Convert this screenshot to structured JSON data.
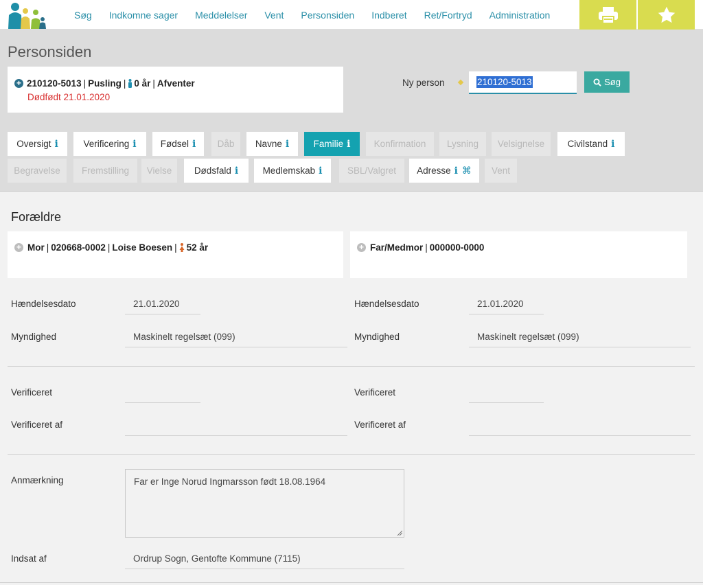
{
  "nav": {
    "items": [
      "Søg",
      "Indkomne sager",
      "Meddelelser",
      "Vent",
      "Personsiden",
      "Indberet",
      "Ret/Fortryd",
      "Administration"
    ]
  },
  "page": {
    "title": "Personsiden"
  },
  "person": {
    "cpr": "210120-5013",
    "name": "Pusling",
    "age": "0 år",
    "status": "Afventer",
    "death_note": "Dødfødt 21.01.2020"
  },
  "search": {
    "label": "Ny person",
    "value": "210120-5013",
    "button_label": "Søg"
  },
  "tabs_row1": [
    {
      "label": "Oversigt",
      "state": "enabled",
      "info": true
    },
    {
      "label": "Verificering",
      "state": "enabled",
      "info": true
    },
    {
      "label": "Fødsel",
      "state": "enabled",
      "info": true
    },
    {
      "label": "Dåb",
      "state": "disabled",
      "info": false
    },
    {
      "label": "Navne",
      "state": "enabled",
      "info": true
    },
    {
      "label": "Familie",
      "state": "active",
      "info": true
    },
    {
      "label": "Konfirmation",
      "state": "disabled",
      "info": false
    },
    {
      "label": "Lysning",
      "state": "disabled",
      "info": false
    },
    {
      "label": "Velsignelse",
      "state": "disabled",
      "info": false
    },
    {
      "label": "Civilstand",
      "state": "enabled",
      "info": true
    }
  ],
  "tabs_row2": [
    {
      "label": "Begravelse",
      "state": "disabled",
      "info": false
    },
    {
      "label": "Fremstilling",
      "state": "disabled",
      "info": false
    },
    {
      "label": "Vielse",
      "state": "disabled",
      "info": false
    },
    {
      "label": "Dødsfald",
      "state": "enabled",
      "info": true
    },
    {
      "label": "Medlemskab",
      "state": "enabled",
      "info": true
    },
    {
      "label": "SBL/Valgret",
      "state": "disabled",
      "info": false
    },
    {
      "label": "Adresse",
      "state": "enabled",
      "info": true
    },
    {
      "label": "Vent",
      "state": "disabled",
      "info": false
    }
  ],
  "parents": {
    "title": "Forældre",
    "mother": {
      "role": "Mor",
      "cpr": "020668-0002",
      "name": "Loise Boesen",
      "age": "52 år"
    },
    "father": {
      "role": "Far/Medmor",
      "cpr": "000000-0000"
    }
  },
  "fields": {
    "haendelsesdato_label": "Hændelsesdato",
    "myndighed_label": "Myndighed",
    "verificeret_label": "Verificeret",
    "verificeret_af_label": "Verificeret af",
    "mother_date": "21.01.2020",
    "mother_authority": "Maskinelt regelsæt (099)",
    "father_date": "21.01.2020",
    "father_authority": "Maskinelt regelsæt (099)"
  },
  "remark": {
    "label": "Anmærkning",
    "text": "Far er Inge Norud Ingmarsson født 18.08.1964",
    "inserted_label": "Indsat af",
    "inserted_by": "Ordrup Sogn, Gentofte Kommune (7115)"
  },
  "colors": {
    "accent": "#2a8fa8",
    "active_tab": "#14a2b0",
    "toolbar_yellow": "#d9dc4f",
    "death_red": "#d83030"
  }
}
